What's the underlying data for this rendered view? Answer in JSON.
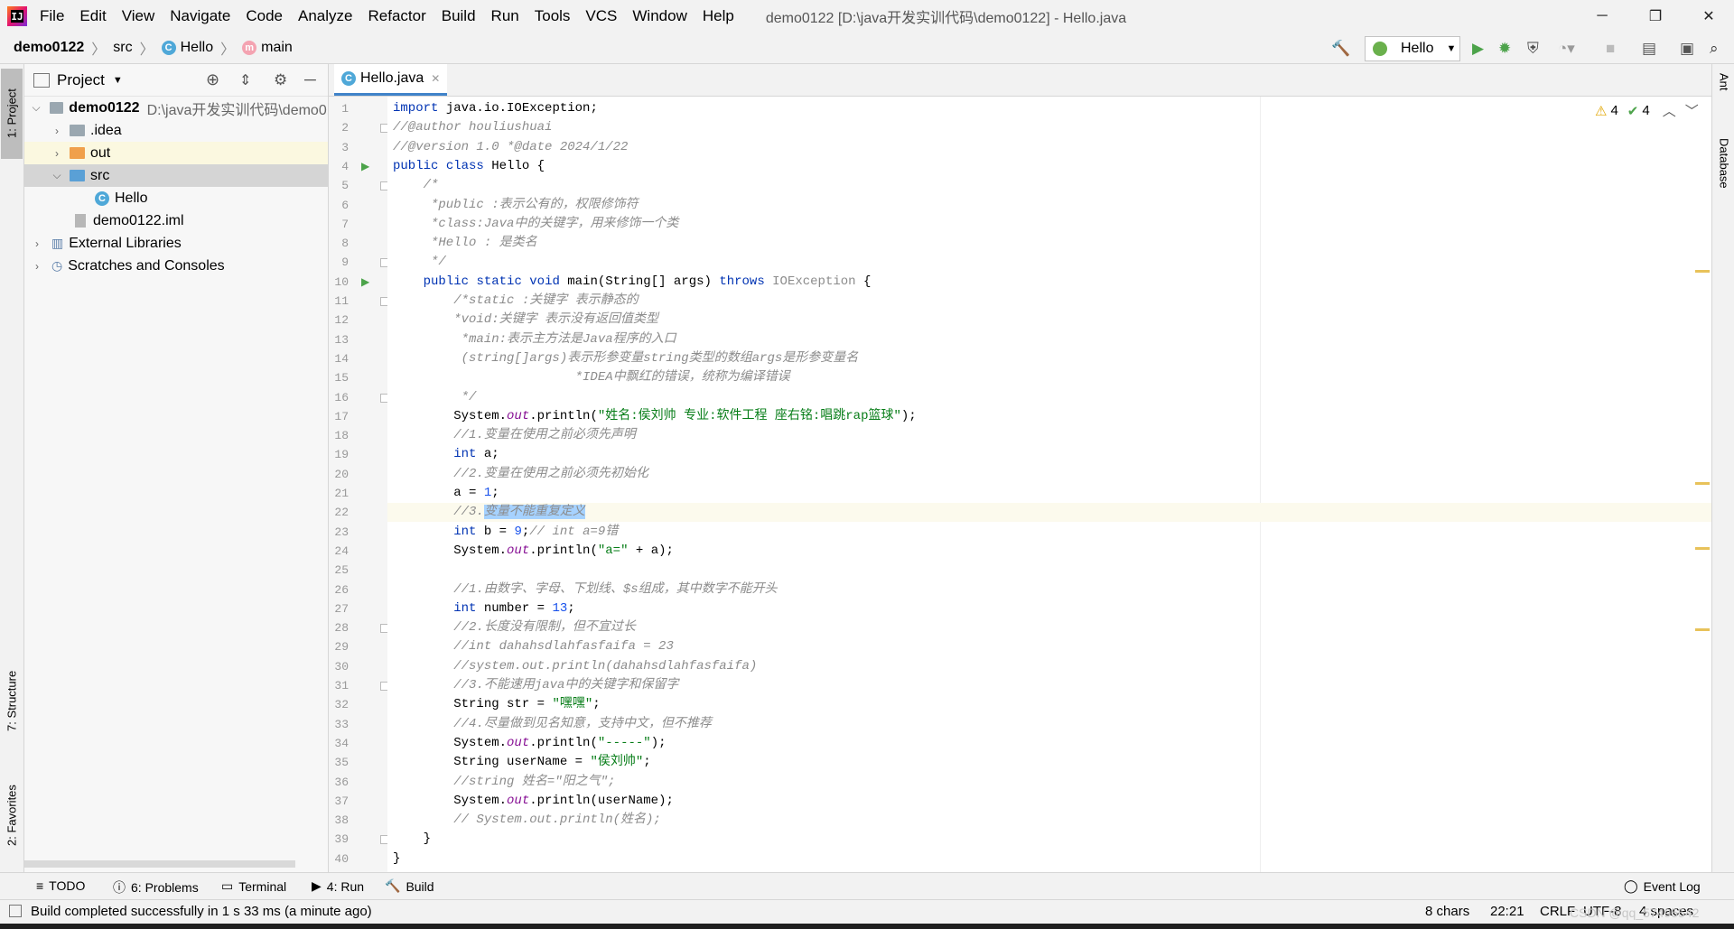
{
  "window": {
    "title": "demo0122 [D:\\java开发实训代码\\demo0122] - Hello.java",
    "minimize": "─",
    "maximize": "❐",
    "close": "✕"
  },
  "menu": [
    "File",
    "Edit",
    "View",
    "Navigate",
    "Code",
    "Analyze",
    "Refactor",
    "Build",
    "Run",
    "Tools",
    "VCS",
    "Window",
    "Help"
  ],
  "breadcrumb": {
    "project": "demo0122",
    "folder": "src",
    "class_icon": "C",
    "class": "Hello",
    "method_icon": "m",
    "method": "main"
  },
  "toolbar": {
    "run_config": "Hello",
    "icons": [
      "hammer-icon",
      "run-icon",
      "debug-icon",
      "coverage-icon",
      "profile-icon",
      "stop-icon",
      "project-structure-icon",
      "split-icon",
      "search-icon"
    ]
  },
  "left_strip": {
    "project_tab": "1: Project",
    "structure_tab": "7: Structure",
    "favorites_tab": "2: Favorites"
  },
  "right_strip": {
    "ant_tab": "Ant",
    "database_tab": "Database"
  },
  "project_panel": {
    "title": "Project",
    "tree": [
      {
        "label": "demo0122",
        "path": "D:\\java开发实训代码\\demo0122",
        "level": 0,
        "expanded": true,
        "kind": "module"
      },
      {
        "label": ".idea",
        "level": 1,
        "expanded": false,
        "kind": "folder-gray"
      },
      {
        "label": "out",
        "level": 1,
        "expanded": false,
        "kind": "folder-orange"
      },
      {
        "label": "src",
        "level": 1,
        "expanded": true,
        "kind": "folder-blue"
      },
      {
        "label": "Hello",
        "level": 2,
        "kind": "class"
      },
      {
        "label": "demo0122.iml",
        "level": 1,
        "kind": "file"
      },
      {
        "label": "External Libraries",
        "level": 0,
        "expanded": false,
        "kind": "library"
      },
      {
        "label": "Scratches and Consoles",
        "level": 0,
        "expanded": false,
        "kind": "scratch"
      }
    ]
  },
  "editor": {
    "tab_label": "Hello.java",
    "tab_close": "✕",
    "warnings": "4",
    "weak_warnings": "4",
    "active_line": 22,
    "lines": [
      "import java.io.IOException;",
      "//@author houliushuai",
      "//@version 1.0 *@date 2024/1/22",
      "public class Hello {",
      "    /*",
      "     *public :表示公有的，权限修饰符",
      "     *class:Java中的关键字，用来修饰一个类",
      "     *Hello : 是类名",
      "     */",
      "    public static void main(String[] args) throws IOException {",
      "        /*static :关键字 表示静态的",
      "        *void:关键字 表示没有返回值类型",
      "         *main:表示主方法是Java程序的入口",
      "         (string[]args)表示形参变量string类型的数组args是形参变量名",
      "                        *IDEA中飘红的错误，统称为编译错误",
      "         */",
      "        System.out.println(\"姓名:侯刘帅 专业:软件工程 座右铭:唱跳rap篮球\");",
      "        //1.变量在使用之前必须先声明",
      "        int a;",
      "        //2.变量在使用之前必须先初始化",
      "        a = 1;",
      "        //3.变量不能重复定义",
      "        int b = 9;// int a=9错",
      "        System.out.println(\"a=\" + a);",
      "",
      "        //1.由数字、字母、下划线、$s组成，其中数字不能开头",
      "        int number = 13;",
      "        //2.长度没有限制，但不宜过长",
      "        //int dahahsdlahfasfaifa = 23",
      "        //system.out.println(dahahsdlahfasfaifa)",
      "        //3.不能速用java中的关键字和保留字",
      "        String str = \"嘿嘿\";",
      "        //4.尽量做到见名知意，支持中文，但不推荐",
      "        System.out.println(\"-----\");",
      "        String userName = \"侯刘帅\";",
      "        //string 姓名=\"阳之气\";",
      "        System.out.println(userName);",
      "        // System.out.println(姓名);",
      "    }",
      "}"
    ]
  },
  "bottom_tools": {
    "todo": "TODO",
    "problems": "6: Problems",
    "terminal": "Terminal",
    "run": "4: Run",
    "build": "Build",
    "event_log": "Event Log"
  },
  "status": {
    "message": "Build completed successfully in 1 s 33 ms (a minute ago)",
    "selection": "8 chars",
    "position": "22:21",
    "line_sep": "CRLF",
    "encoding": "UTF-8",
    "indent": "4 spaces",
    "watermark": "CSDN @qq_57495542"
  }
}
